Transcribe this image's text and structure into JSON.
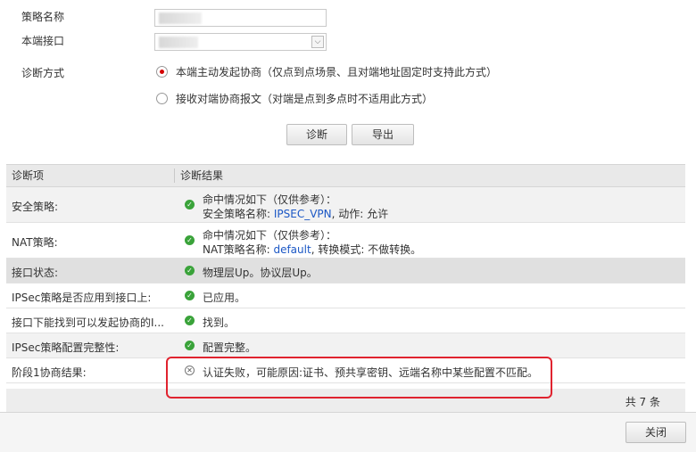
{
  "form": {
    "policy_name_label": "策略名称",
    "local_interface_label": "本端接口",
    "diag_mode_label": "诊断方式",
    "select_arrow": "⌵",
    "option1": "本端主动发起协商（仅点到点场景、且对端地址固定时支持此方式）",
    "option2": "接收对端协商报文（对端是点到多点时不适用此方式）"
  },
  "buttons": {
    "diagnose": "诊断",
    "export": "导出",
    "close": "关闭"
  },
  "table": {
    "headers": [
      "诊断项",
      "诊断结果"
    ],
    "rows": [
      {
        "item": "安全策略:",
        "line1": "命中情况如下（仅供参考）：",
        "line2_prefix": "安全策略名称: ",
        "line2_link": "IPSEC_VPN",
        "line2_suffix": ", 动作: 允许"
      },
      {
        "item": "NAT策略:",
        "line1": "命中情况如下（仅供参考）：",
        "line2_prefix": "NAT策略名称: ",
        "line2_link": "default",
        "line2_suffix": ", 转换模式: 不做转换。"
      },
      {
        "item": "接口状态:",
        "result": "物理层Up。协议层Up。"
      },
      {
        "item": "IPSec策略是否应用到接口上:",
        "result": "已应用。"
      },
      {
        "item": "接口下能找到可以发起协商的I...",
        "result": "找到。"
      },
      {
        "item": "IPSec策略配置完整性:",
        "result": "配置完整。"
      },
      {
        "item": "阶段1协商结果:",
        "result": "认证失败，可能原因:证书、预共享密钥、远端名称中某些配置不匹配。"
      }
    ],
    "total": "共 7 条"
  },
  "icons": {
    "ok": "✓",
    "fail": "✕"
  },
  "colors": {
    "ok": "#3aa33a",
    "link": "#1b57c5",
    "highlight": "#e0232f",
    "radio": "#d40000"
  }
}
